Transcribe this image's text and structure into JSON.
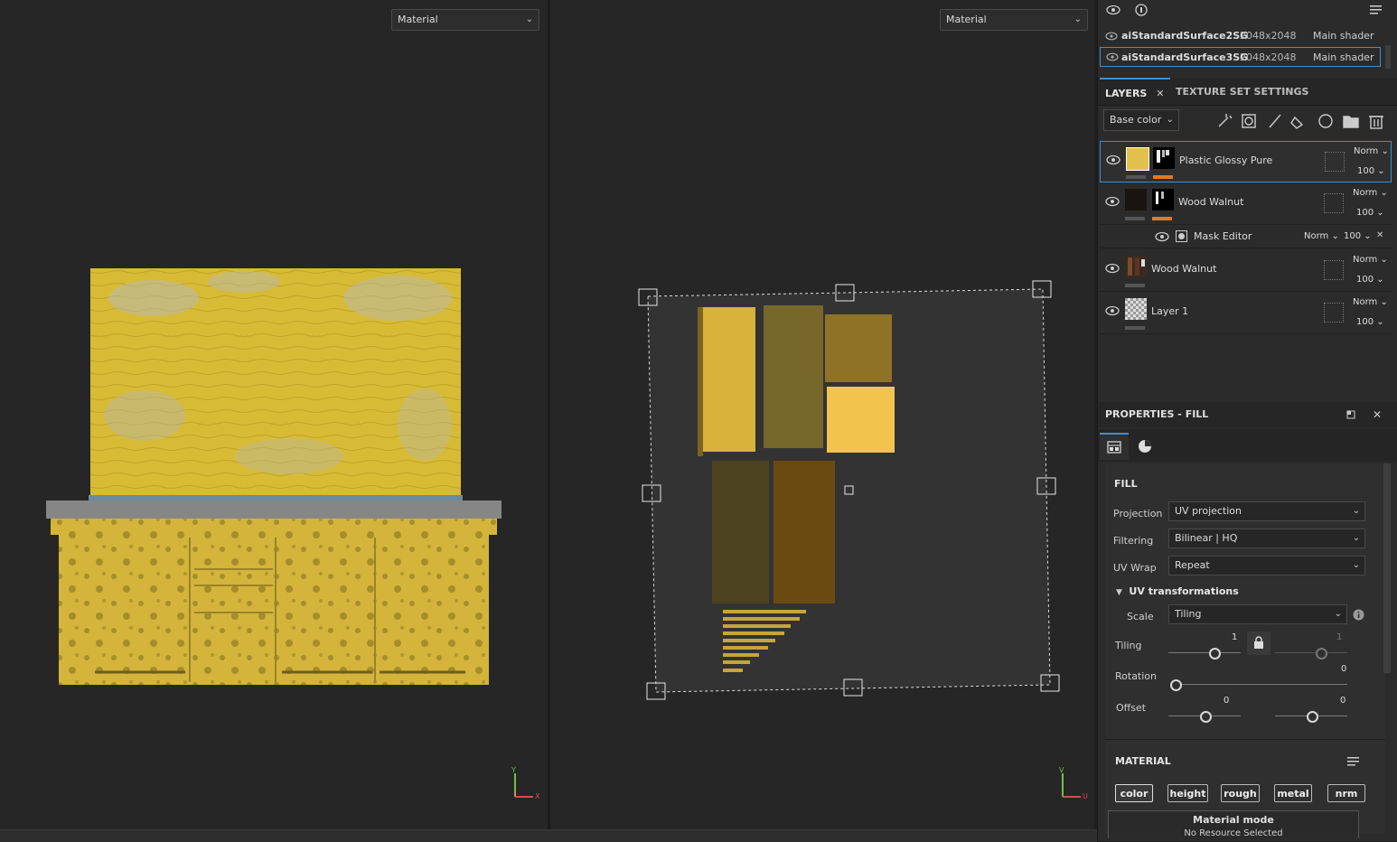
{
  "viewport3d": {
    "mode_label": "Material",
    "axis_y": "Y",
    "axis_x": "X"
  },
  "viewport2d": {
    "mode_label": "Material",
    "axis_v": "V",
    "axis_u": "U"
  },
  "texture_sets": [
    {
      "name": "aiStandardSurface2SG",
      "resolution": "2048x2048",
      "shader": "Main shader",
      "selected": false
    },
    {
      "name": "aiStandardSurface3SG",
      "resolution": "2048x2048",
      "shader": "Main shader",
      "selected": true
    }
  ],
  "tabs": {
    "layers": "LAYERS",
    "texture_set_settings": "TEXTURE SET SETTINGS"
  },
  "channel_select": "Base color",
  "layers": [
    {
      "name": "Plastic Glossy Pure",
      "blend": "Norm",
      "opacity": "100"
    },
    {
      "name": "Wood Walnut",
      "blend": "Norm",
      "opacity": "100"
    },
    {
      "name": "Wood Walnut",
      "blend": "Norm",
      "opacity": "100"
    },
    {
      "name": "Layer 1",
      "blend": "Norm",
      "opacity": "100"
    }
  ],
  "mask_editor": {
    "name": "Mask Editor",
    "blend": "Norm",
    "opacity": "100"
  },
  "properties": {
    "title": "PROPERTIES - FILL",
    "section_fill": "FILL",
    "projection_label": "Projection",
    "projection_value": "UV projection",
    "filtering_label": "Filtering",
    "filtering_value": "Bilinear | HQ",
    "uvwrap_label": "UV Wrap",
    "uvwrap_value": "Repeat",
    "uvt_label": "UV transformations",
    "scale_label": "Scale",
    "scale_value": "Tiling",
    "tiling_label": "Tiling",
    "tiling_u": "1",
    "tiling_v": "1",
    "rotation_label": "Rotation",
    "rotation_value": "0",
    "offset_label": "Offset",
    "offset_u": "0",
    "offset_v": "0",
    "section_material": "MATERIAL",
    "channels": [
      "color",
      "height",
      "rough",
      "metal",
      "nrm"
    ],
    "material_mode_title": "Material mode",
    "material_mode_sub": "No Resource Selected"
  },
  "colors": {
    "accent": "#3c8fd6",
    "orange": "#e07b22",
    "yellow": "#e3c04a"
  }
}
